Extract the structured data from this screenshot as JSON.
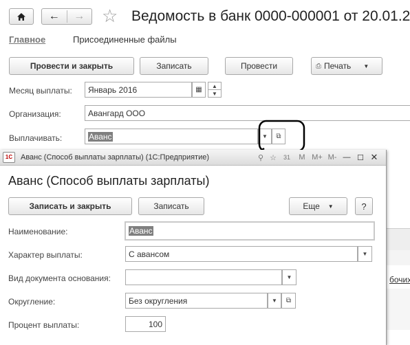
{
  "main": {
    "title": "Ведомость в банк 0000-000001 от 20.01.2",
    "nav_tabs": [
      "Главное",
      "Присоединенные файлы"
    ],
    "toolbar": {
      "post_close": "Провести и закрыть",
      "save": "Записать",
      "post": "Провести",
      "print": "Печать"
    },
    "fields": {
      "month_label": "Месяц выплаты:",
      "month_value": "Январь 2016",
      "org_label": "Организация:",
      "org_value": "Авангард ООО",
      "pay_label": "Выплачивать:",
      "pay_value": "Аванс"
    },
    "partial_right_text": "бочих"
  },
  "dialog": {
    "window_title": "Аванс (Способ выплаты зарплаты)  (1С:Предприятие)",
    "heading": "Аванс (Способ выплаты зарплаты)",
    "toolbar": {
      "save_close": "Записать и закрыть",
      "save": "Записать",
      "more": "Еще",
      "help": "?"
    },
    "fields": {
      "name_label": "Наименование:",
      "name_value": "Аванс",
      "nature_label": "Характер выплаты:",
      "nature_value": "С авансом",
      "basis_label": "Вид документа основания:",
      "basis_value": "",
      "rounding_label": "Округление:",
      "rounding_value": "Без округления",
      "percent_label": "Процент выплаты:",
      "percent_value": "100"
    },
    "title_buttons": [
      "M",
      "M+",
      "M-"
    ]
  }
}
